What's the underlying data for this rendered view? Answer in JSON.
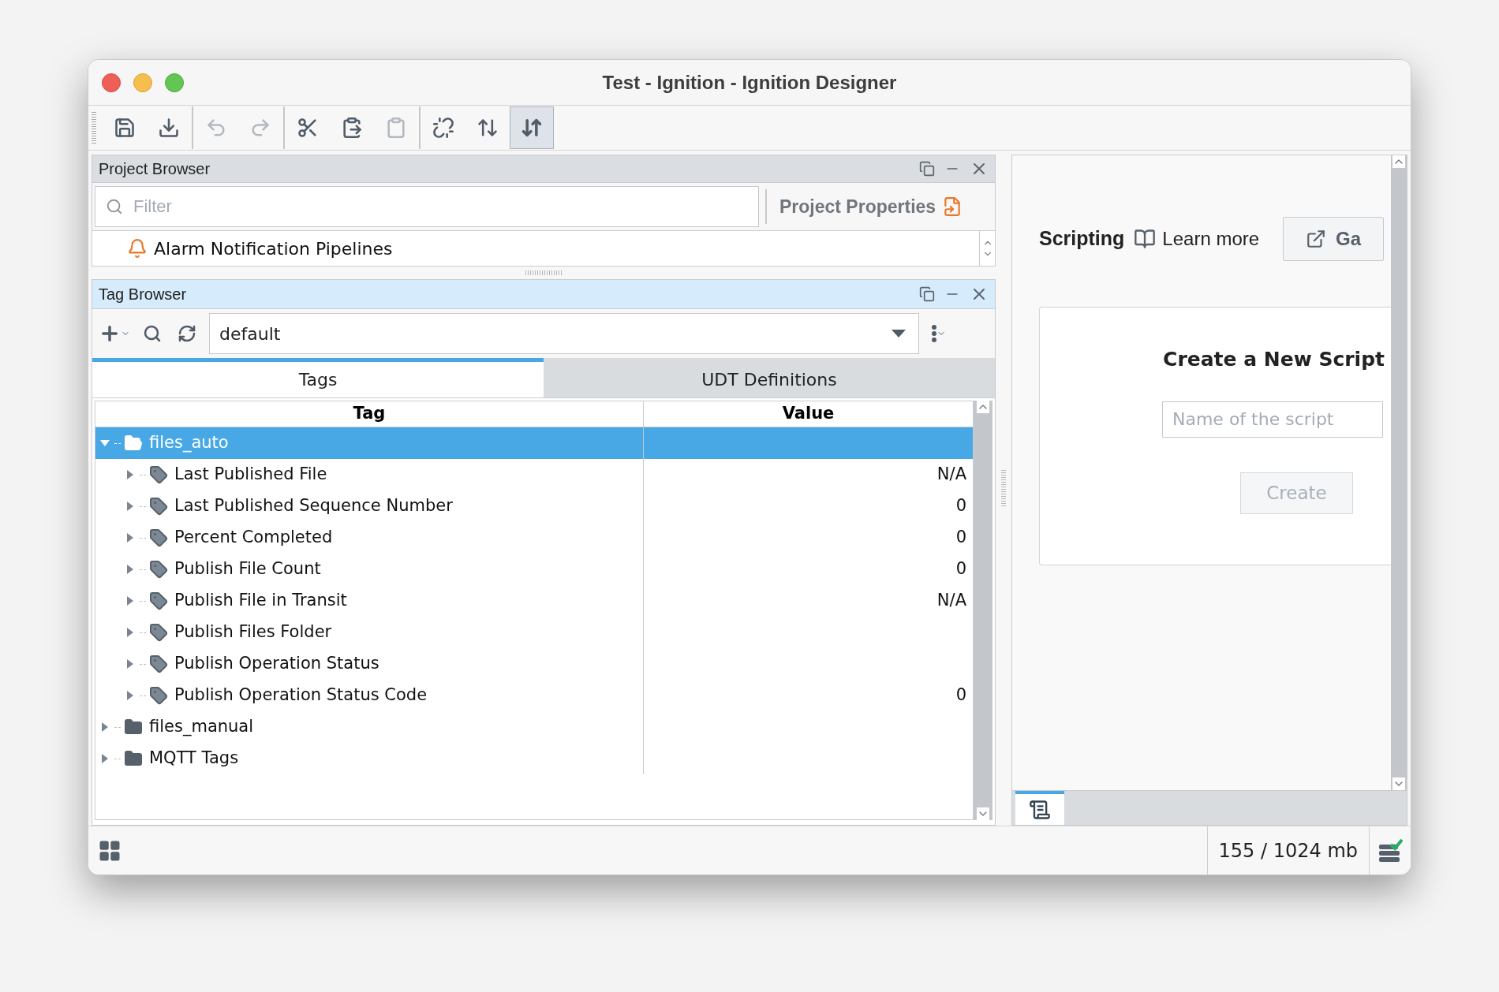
{
  "window": {
    "title": "Test - Ignition - Ignition Designer"
  },
  "toolbar": {
    "buttons": [
      {
        "kind": "save",
        "disabled": false,
        "selected": false
      },
      {
        "kind": "download",
        "disabled": false,
        "selected": false
      },
      {
        "kind": "undo",
        "disabled": true,
        "selected": false
      },
      {
        "kind": "redo",
        "disabled": true,
        "selected": false
      },
      {
        "kind": "cut",
        "disabled": false,
        "selected": false
      },
      {
        "kind": "paste",
        "disabled": false,
        "selected": false
      },
      {
        "kind": "clipboard",
        "disabled": true,
        "selected": false
      },
      {
        "kind": "unsync",
        "disabled": false,
        "selected": false
      },
      {
        "kind": "swap",
        "disabled": false,
        "selected": false
      },
      {
        "kind": "swapbold",
        "disabled": false,
        "selected": true
      }
    ]
  },
  "project_browser": {
    "title": "Project Browser",
    "filter_placeholder": "Filter",
    "properties_button": "Project Properties",
    "tree": [
      {
        "label": "Alarm Notification Pipelines"
      }
    ]
  },
  "tag_browser": {
    "title": "Tag Browser",
    "provider": "default",
    "tabs": [
      {
        "label": "Tags",
        "selected": true
      },
      {
        "label": "UDT Definitions",
        "selected": false
      }
    ],
    "columns": [
      "Tag",
      "Value"
    ],
    "tree": [
      {
        "kind": "folder",
        "label": "files_auto",
        "expanded": true,
        "selected": true,
        "children": [
          {
            "kind": "tag",
            "label": "Last Published File",
            "value": "N/A",
            "expanded": false,
            "selected": false
          },
          {
            "kind": "tag",
            "label": "Last Published Sequence Number",
            "value": "0",
            "expanded": false,
            "selected": false
          },
          {
            "kind": "tag",
            "label": "Percent Completed",
            "value": "0",
            "expanded": false,
            "selected": false
          },
          {
            "kind": "tag",
            "label": "Publish File Count",
            "value": "0",
            "expanded": false,
            "selected": false
          },
          {
            "kind": "tag",
            "label": "Publish File in Transit",
            "value": "N/A",
            "expanded": false,
            "selected": false
          },
          {
            "kind": "tag",
            "label": "Publish Files Folder",
            "expanded": false,
            "selected": false
          },
          {
            "kind": "tag",
            "label": "Publish Operation Status",
            "expanded": false,
            "selected": false
          },
          {
            "kind": "tag",
            "label": "Publish Operation Status Code",
            "value": "0",
            "expanded": false,
            "selected": false
          }
        ]
      },
      {
        "kind": "folder",
        "label": "files_manual",
        "expanded": false,
        "selected": false
      },
      {
        "kind": "folder",
        "label": "MQTT Tags",
        "expanded": false,
        "selected": false
      }
    ]
  },
  "scripting": {
    "title": "Scripting",
    "learn_more": "Learn more",
    "gallery_button": "Ga",
    "card_title": "Create a New Script",
    "name_placeholder": "Name of the script",
    "create_button": {
      "label": "Create",
      "disabled": true
    }
  },
  "status_bar": {
    "memory": "155 / 1024 mb"
  }
}
